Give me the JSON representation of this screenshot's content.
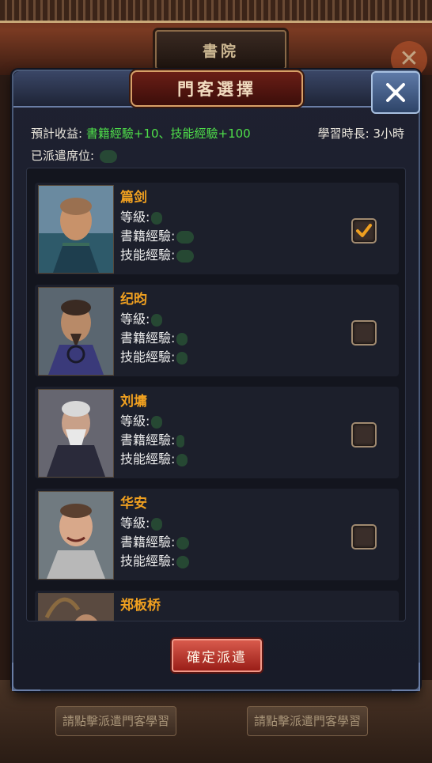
{
  "background": {
    "banner_title": "書院",
    "bottom_buttons": [
      "請點擊派遣門客學習",
      "請點擊派遣門客學習"
    ]
  },
  "dialog": {
    "title": "門客選擇",
    "expected_gain_label": "預計收益:",
    "expected_gain_value": "書籍經驗+10、技能經驗+100",
    "study_duration": "學習時長: 3小時",
    "dispatched_seats_label": "已派遣席位:"
  },
  "hero_list": [
    {
      "name": "篇剑",
      "level_label": "等級:",
      "book_exp_label": "書籍經驗:",
      "skill_exp_label": "技能經驗:",
      "selected": true
    },
    {
      "name": "纪昀",
      "level_label": "等級:",
      "book_exp_label": "書籍經驗:",
      "skill_exp_label": "技能經驗:",
      "selected": false
    },
    {
      "name": "刘墉",
      "level_label": "等級:",
      "book_exp_label": "書籍經驗:",
      "skill_exp_label": "技能經驗:",
      "selected": false
    },
    {
      "name": "华安",
      "level_label": "等級:",
      "book_exp_label": "書籍經驗:",
      "skill_exp_label": "技能經驗:",
      "selected": false
    },
    {
      "name": "郑板桥"
    }
  ],
  "confirm_button": "確定派遣",
  "colors": {
    "name": "#f0a020",
    "gain_value": "#4fe04a",
    "confirm_button": "#b8302a",
    "checkmark": "#f0a020"
  },
  "icons": [
    "close-icon",
    "checkmark-icon"
  ]
}
